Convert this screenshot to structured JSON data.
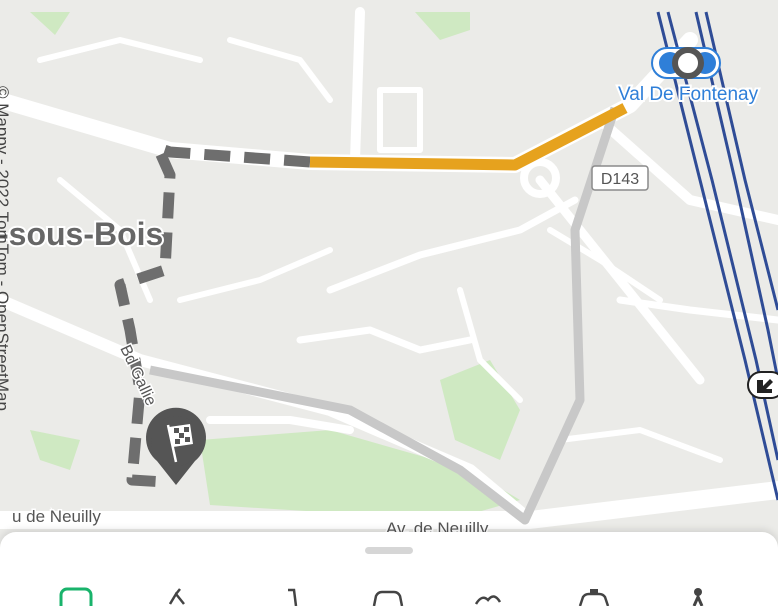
{
  "map": {
    "attribution": "© Mappy - 2022 TomTom - OpenStreetMap",
    "labels": {
      "town": "-sous-Bois",
      "station": "Val De Fontenay",
      "road_shield": "D143",
      "street_boulevard": "Bd Gallie",
      "street_neuilly_left": "u de Neuilly",
      "street_neuilly_center": "Av. de Neuilly"
    },
    "route_colors": {
      "walk": "#6e6e6e",
      "traffic": "#e6a21e",
      "alternative": "#c8c8c8",
      "rail": "#2f4c96"
    },
    "markers": {
      "destination_icon": "checkered-flag-icon",
      "station_icon": "transit-station-icon",
      "edge_icon": "highway-exit-icon"
    }
  },
  "bottom_sheet": {
    "tabs": [
      {
        "name": "tab-transit",
        "icon": "bus-icon",
        "active": true,
        "color": "#19b36b"
      },
      {
        "name": "tab-bike",
        "icon": "bike-icon",
        "active": false
      },
      {
        "name": "tab-scooter",
        "icon": "scooter-icon",
        "active": false
      },
      {
        "name": "tab-car",
        "icon": "car-icon",
        "active": false
      },
      {
        "name": "tab-motorbike",
        "icon": "motorbike-icon",
        "active": false
      },
      {
        "name": "tab-taxi",
        "icon": "taxi-icon",
        "active": false
      },
      {
        "name": "tab-walk",
        "icon": "walk-icon",
        "active": false
      }
    ]
  }
}
